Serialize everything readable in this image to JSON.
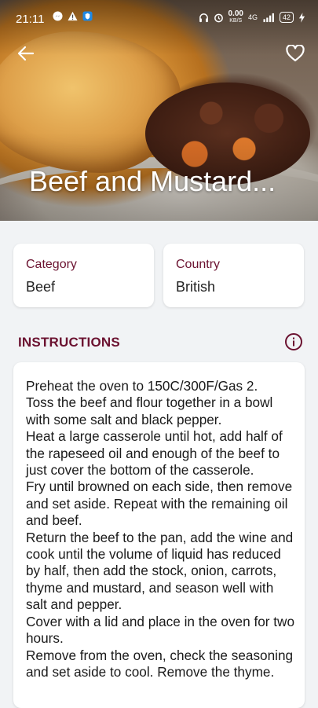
{
  "status_bar": {
    "time": "21:11",
    "network_speed": "0.00",
    "network_speed_unit": "KB/S",
    "network_type": "4G",
    "battery": "42",
    "left_icons": [
      "messenger-icon",
      "warning-icon",
      "vpn-shield-icon"
    ],
    "right_icons": [
      "headphones-icon",
      "alarm-icon",
      "signal-icon",
      "charging-icon"
    ]
  },
  "header": {
    "title": "Beef and Mustard...",
    "back_icon": "arrow-left-icon",
    "favorite_icon": "heart-outline-icon"
  },
  "category": {
    "label": "Category",
    "value": "Beef"
  },
  "country": {
    "label": "Country",
    "value": "British"
  },
  "instructions": {
    "heading": "INSTRUCTIONS",
    "info_icon": "info-icon",
    "text": "Preheat the oven to 150C/300F/Gas 2.\nToss the beef and flour together in a bowl with some salt and black pepper.\nHeat a large casserole until hot, add half of the rapeseed oil and enough of the beef to just cover the bottom of the casserole.\nFry until browned on each side, then remove and set aside. Repeat with the remaining oil and beef.\nReturn the beef to the pan, add the wine and cook until the volume of liquid has reduced by half, then add the stock, onion, carrots, thyme and mustard, and season well with salt and pepper.\nCover with a lid and place in the oven for two hours.\nRemove from the oven, check the seasoning and set aside to cool. Remove the thyme."
  },
  "colors": {
    "accent": "#6b1230",
    "background": "#f1f3f5",
    "card": "#ffffff"
  }
}
